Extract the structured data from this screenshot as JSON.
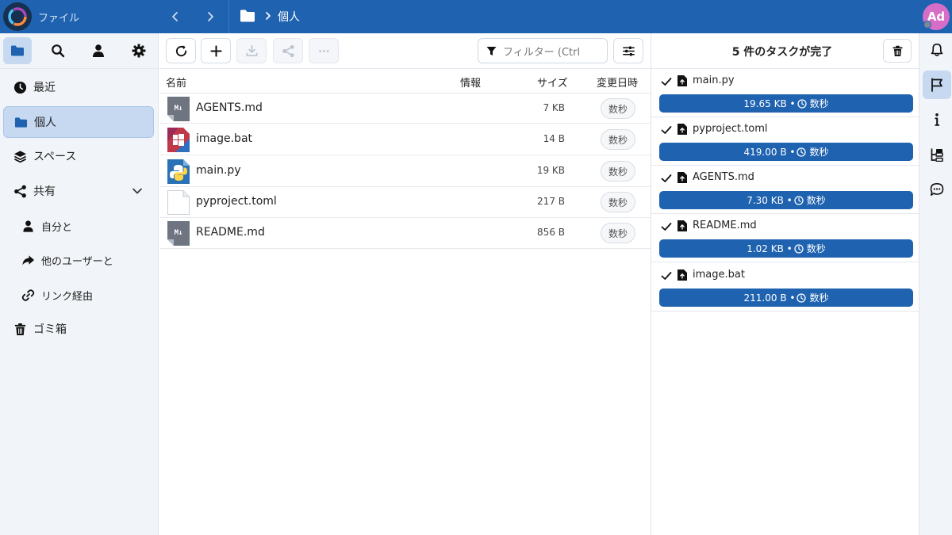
{
  "header": {
    "app_title": "ファイル",
    "breadcrumb": "個人",
    "avatar_initials": "Ad"
  },
  "sidebar": {
    "items": [
      {
        "label": "最近",
        "icon": "clock-icon"
      },
      {
        "label": "個人",
        "icon": "folder-icon",
        "active": true
      },
      {
        "label": "スペース",
        "icon": "layers-icon"
      },
      {
        "label": "共有",
        "icon": "share-icon"
      },
      {
        "label": "自分と",
        "icon": "user-icon"
      },
      {
        "label": "他のユーザーと",
        "icon": "forward-icon"
      },
      {
        "label": "リンク経由",
        "icon": "link-icon"
      },
      {
        "label": "ゴミ箱",
        "icon": "trash-icon"
      }
    ]
  },
  "toolbar": {
    "filter_placeholder": "フィルター (Ctrl"
  },
  "table": {
    "headers": {
      "name": "名前",
      "info": "情報",
      "size": "サイズ",
      "modified": "変更日時"
    },
    "rows": [
      {
        "name": "AGENTS.md",
        "size": "7 KB",
        "modified": "数秒",
        "icon": "markdown-file-icon"
      },
      {
        "name": "image.bat",
        "size": "14 B",
        "modified": "数秒",
        "icon": "windows-file-icon"
      },
      {
        "name": "main.py",
        "size": "19 KB",
        "modified": "数秒",
        "icon": "python-file-icon"
      },
      {
        "name": "pyproject.toml",
        "size": "217 B",
        "modified": "数秒",
        "icon": "blank-file-icon"
      },
      {
        "name": "README.md",
        "size": "856 B",
        "modified": "数秒",
        "icon": "markdown-file-icon"
      }
    ]
  },
  "tasks": {
    "title": "5 件のタスクが完了",
    "items": [
      {
        "name": "main.py",
        "size": "19.65 KB •",
        "time": "数秒"
      },
      {
        "name": "pyproject.toml",
        "size": "419.00 B •",
        "time": "数秒"
      },
      {
        "name": "AGENTS.md",
        "size": "7.30 KB •",
        "time": "数秒"
      },
      {
        "name": "README.md",
        "size": "1.02 KB •",
        "time": "数秒"
      },
      {
        "name": "image.bat",
        "size": "211.00 B •",
        "time": "数秒"
      }
    ]
  },
  "colors": {
    "brand": "#1f62b0",
    "active_bg": "#c6d9f0",
    "avatar": "#d66ec7"
  }
}
